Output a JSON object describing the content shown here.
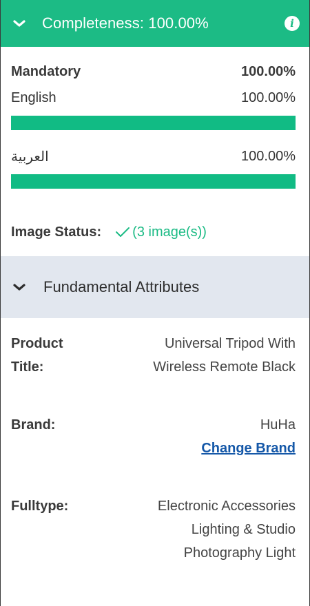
{
  "completeness": {
    "title": "Completeness: 100.00%",
    "mandatory": {
      "label": "Mandatory",
      "value": "100.00%"
    },
    "languages": [
      {
        "label": "English",
        "value": "100.00%",
        "fill": 1.0
      },
      {
        "label": "العربية",
        "value": "100.00%",
        "fill": 1.0
      }
    ],
    "image_status": {
      "label": "Image Status:",
      "count": "(3 image(s))"
    }
  },
  "fundamental": {
    "title": "Fundamental Attributes",
    "product_title": {
      "label_1": "Product",
      "label_2": "Title:",
      "value_1": "Universal Tripod With",
      "value_2": "Wireless Remote Black"
    },
    "brand": {
      "label": "Brand:",
      "value": "HuHa",
      "change_label": "Change Brand"
    },
    "fulltype": {
      "label": "Fulltype:",
      "value_1": "Electronic Accessories",
      "value_2": "Lighting & Studio",
      "value_3": "Photography Light"
    }
  },
  "colors": {
    "accent": "#1cbb85",
    "bar_fill": "#11bb84",
    "section_bg": "#e2e7ef",
    "link": "#1558a8"
  }
}
